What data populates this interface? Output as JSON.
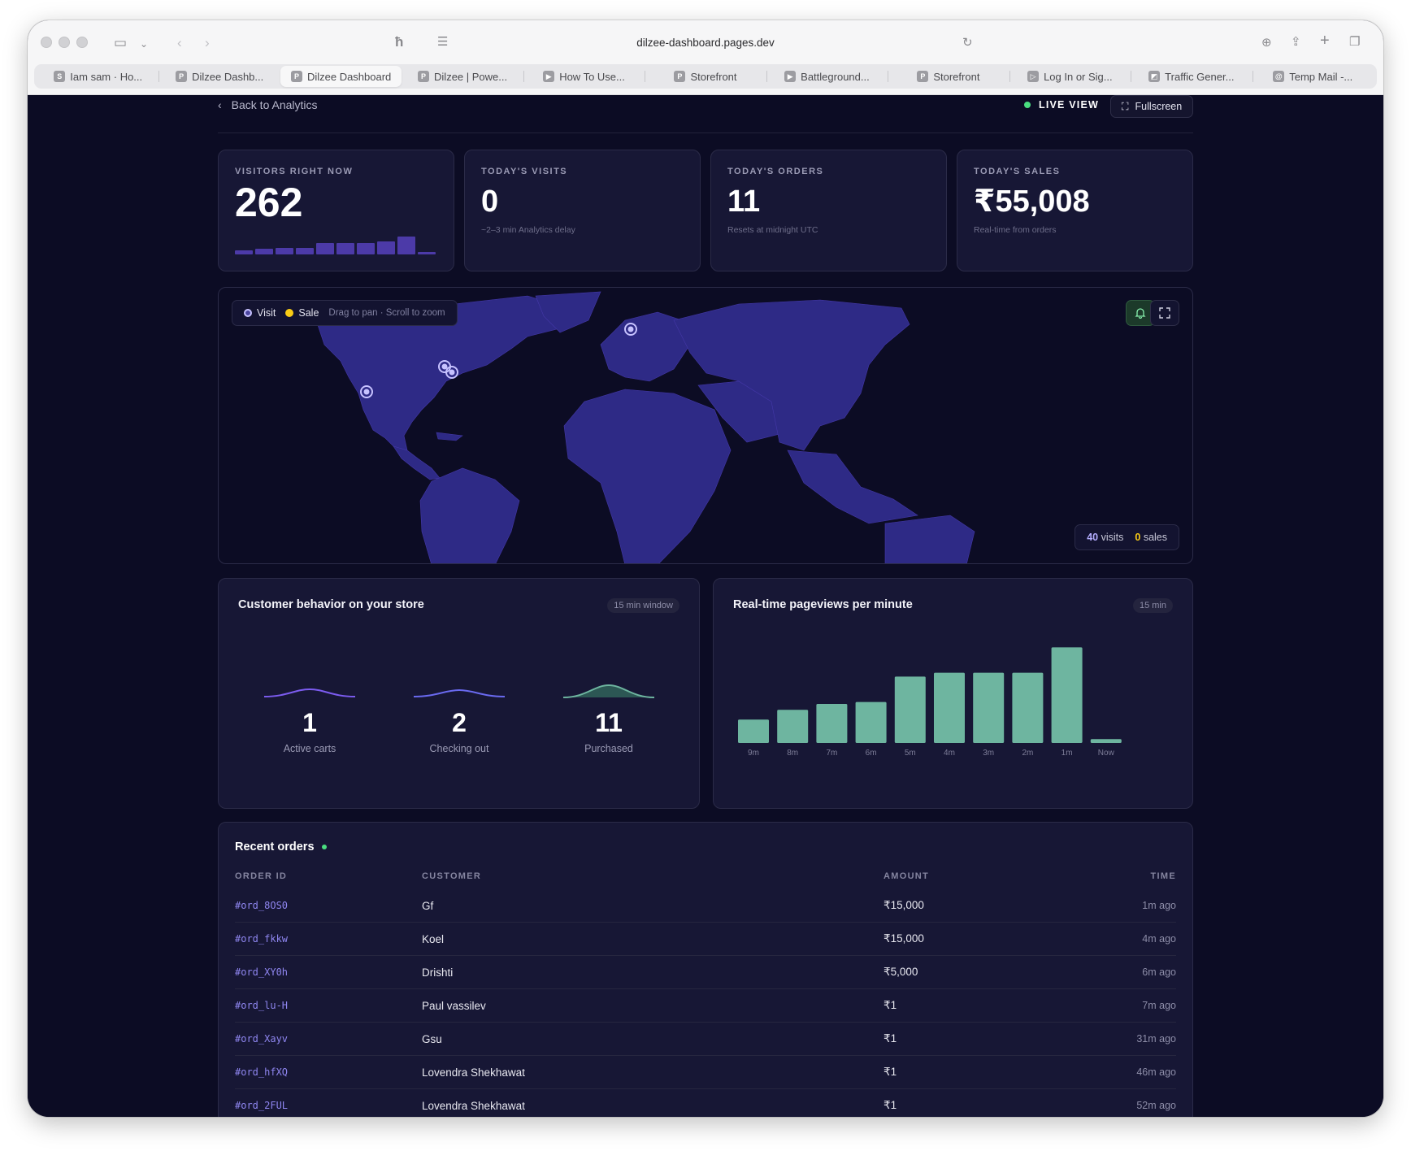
{
  "browser": {
    "url": "dilzee-dashboard.pages.dev",
    "tabs": [
      {
        "label": "Iam sam · Ho...",
        "fav": "S",
        "active": false
      },
      {
        "label": "Dilzee Dashb...",
        "fav": "P",
        "active": false
      },
      {
        "label": "Dilzee Dashboard",
        "fav": "P",
        "active": true
      },
      {
        "label": "Dilzee | Powe...",
        "fav": "P",
        "active": false
      },
      {
        "label": "How To Use...",
        "fav": "▶",
        "active": false
      },
      {
        "label": "Storefront",
        "fav": "P",
        "active": false
      },
      {
        "label": "Battleground...",
        "fav": "▶",
        "active": false
      },
      {
        "label": "Storefront",
        "fav": "P",
        "active": false
      },
      {
        "label": "Log In or Sig...",
        "fav": "▷",
        "active": false
      },
      {
        "label": "Traffic Gener...",
        "fav": "◩",
        "active": false
      },
      {
        "label": "Temp Mail -...",
        "fav": "@",
        "active": false
      }
    ]
  },
  "topbar": {
    "back_label": "Back to Analytics",
    "live_label": "LIVE VIEW",
    "fullscreen_label": "Fullscreen"
  },
  "stats": [
    {
      "label": "VISITORS RIGHT NOW",
      "value": "262",
      "sub": ""
    },
    {
      "label": "TODAY'S VISITS",
      "value": "0",
      "sub": "~2–3 min Analytics delay"
    },
    {
      "label": "TODAY'S ORDERS",
      "value": "11",
      "sub": "Resets at midnight UTC"
    },
    {
      "label": "TODAY'S SALES",
      "value": "₹55,008",
      "sub": "Real-time from orders"
    }
  ],
  "visitors_spark": [
    0.18,
    0.25,
    0.3,
    0.32,
    0.55,
    0.55,
    0.55,
    0.6,
    0.85,
    0.1
  ],
  "map": {
    "legend_visit": "Visit",
    "legend_sale": "Sale",
    "hint": "Drag to pan · Scroll to zoom",
    "visits_count": "40",
    "visits_label": "visits",
    "sales_count": "0",
    "sales_label": "sales",
    "visit_color": "#c7c2ff",
    "sale_color": "#facc15"
  },
  "behavior": {
    "title": "Customer behavior on your store",
    "window_label": "15 min window",
    "items": [
      {
        "value": "1",
        "label": "Active carts"
      },
      {
        "value": "2",
        "label": "Checking out"
      },
      {
        "value": "11",
        "label": "Purchased"
      }
    ]
  },
  "pageviews": {
    "title": "Real-time pageviews per minute",
    "window_label": "15 min"
  },
  "chart_data": {
    "type": "bar",
    "title": "Real-time pageviews per minute",
    "categories": [
      "9m",
      "8m",
      "7m",
      "6m",
      "5m",
      "4m",
      "3m",
      "2m",
      "1m",
      "Now"
    ],
    "values": [
      6,
      8.5,
      10,
      10.5,
      17,
      18,
      18,
      18,
      24.5,
      1
    ],
    "ylim": [
      0,
      25
    ],
    "color": "#6eb5a0"
  },
  "orders": {
    "title": "Recent orders",
    "headers": [
      "ORDER ID",
      "CUSTOMER",
      "AMOUNT",
      "TIME"
    ],
    "rows": [
      {
        "id": "#ord_8OS0",
        "customer": "Gf",
        "amount": "₹15,000",
        "time": "1m ago"
      },
      {
        "id": "#ord_fkkw",
        "customer": "Koel",
        "amount": "₹15,000",
        "time": "4m ago"
      },
      {
        "id": "#ord_XY0h",
        "customer": "Drishti",
        "amount": "₹5,000",
        "time": "6m ago"
      },
      {
        "id": "#ord_lu-H",
        "customer": "Paul vassilev",
        "amount": "₹1",
        "time": "7m ago"
      },
      {
        "id": "#ord_Xayv",
        "customer": "Gsu",
        "amount": "₹1",
        "time": "31m ago"
      },
      {
        "id": "#ord_hfXQ",
        "customer": "Lovendra Shekhawat",
        "amount": "₹1",
        "time": "46m ago"
      },
      {
        "id": "#ord_2FUL",
        "customer": "Lovendra Shekhawat",
        "amount": "₹1",
        "time": "52m ago"
      }
    ]
  }
}
